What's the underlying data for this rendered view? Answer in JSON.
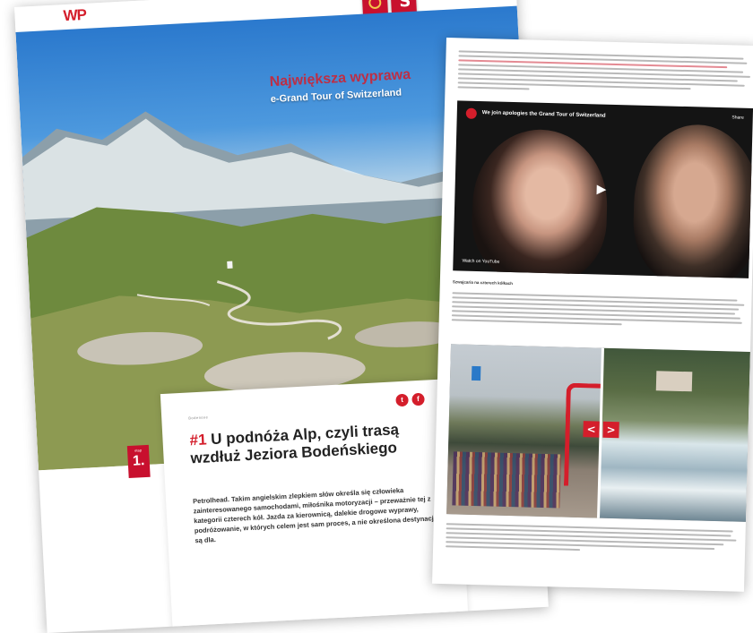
{
  "site": {
    "logo_text": "WP",
    "accent_color": "#d41e2b",
    "nav": [
      {
        "label": "",
        "icon": "nav-link"
      },
      {
        "label": "",
        "icon": "nav-link"
      }
    ]
  },
  "hero": {
    "title": "Największa wyprawa",
    "subtitle": "e-Grand Tour of Switzerland"
  },
  "article": {
    "rank_label": "etap",
    "rank_number": "1.",
    "breadcrumb": "Bodensee",
    "title_number": "#1",
    "title_text": "U podnóża Alp, czyli trasą wzdłuż Jeziora Bodeńskiego",
    "lead": "Petrolhead. Takim angielskim zlepkiem słów określa się człowieka zainteresowanego samochodami, miłośnika motoryzacji – przeważnie tej z kategorii czterech kół. Jazda za kierownicą, dalekie drogowe wyprawy, podróżowanie, w których celem jest sam proces, a nie określona destynacja, są dla."
  },
  "social": [
    {
      "icon": "twitter-icon",
      "label": "t"
    },
    {
      "icon": "facebook-icon",
      "label": "f"
    }
  ],
  "video": {
    "title": "We join apologies the Grand Tour of Switzerland",
    "share_label": "Share",
    "watch_label": "Watch on YouTube"
  },
  "section_heading": "Szwajcaria na czterech kółkach",
  "comparison": {
    "prev_label": "<",
    "next_label": ">",
    "caption_left": "",
    "caption_right": ""
  }
}
